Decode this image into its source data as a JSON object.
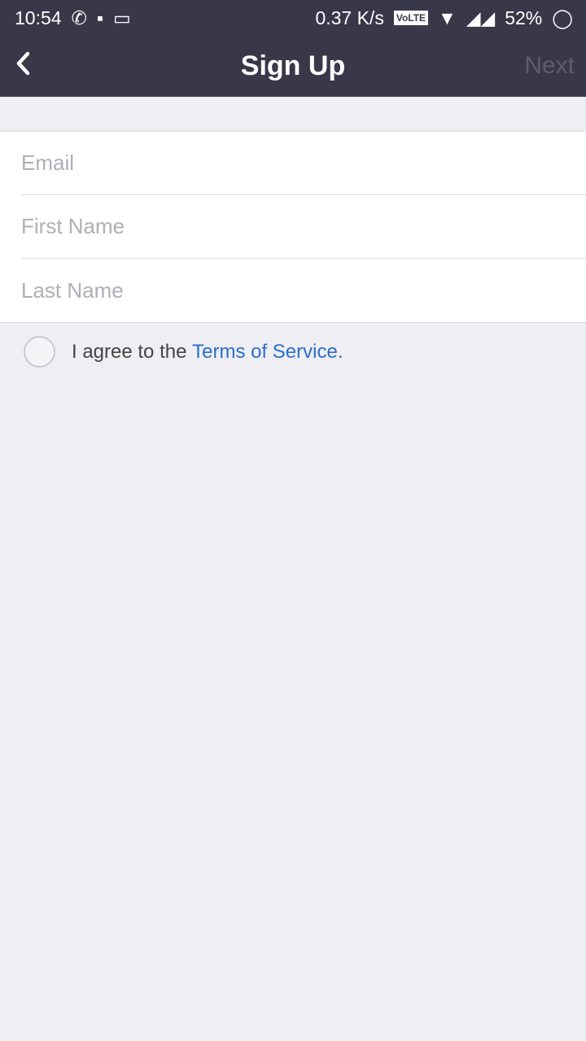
{
  "status": {
    "time": "10:54",
    "speed": "0.37 K/s",
    "volte": "VoLTE",
    "battery": "52%"
  },
  "header": {
    "title": "Sign Up",
    "next": "Next"
  },
  "form": {
    "email_placeholder": "Email",
    "first_placeholder": "First Name",
    "last_placeholder": "Last Name"
  },
  "agree": {
    "text": "I agree to the ",
    "link": "Terms of Service",
    "end": "."
  },
  "colors": {
    "header": "#393849",
    "link": "#2a6fc9",
    "background": "#eeeef3"
  }
}
